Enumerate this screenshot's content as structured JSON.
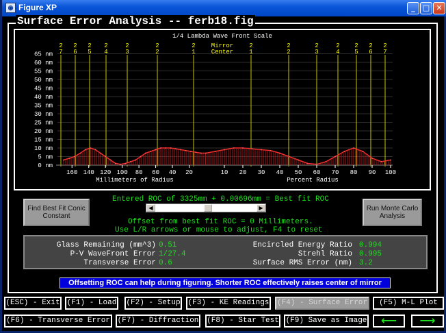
{
  "window": {
    "title": "Figure XP",
    "controls": [
      "_",
      "□",
      "✕"
    ]
  },
  "heading": "Surface Error Analysis -- ferb18.fig",
  "plot": {
    "title": "1/4 Lambda Wave Front Scale",
    "mirror_center_line1": "Mirror",
    "mirror_center_line2": "Center",
    "zone_labels": [
      [
        "2",
        "7"
      ],
      [
        "2",
        "6"
      ],
      [
        "2",
        "5"
      ],
      [
        "2",
        "4"
      ],
      [
        "2",
        "3"
      ],
      [
        "2",
        "2"
      ],
      [
        "2",
        "1"
      ],
      [
        "2",
        "1"
      ],
      [
        "2",
        "2"
      ],
      [
        "2",
        "3"
      ],
      [
        "2",
        "4"
      ],
      [
        "2",
        "5"
      ],
      [
        "2",
        "6"
      ],
      [
        "2",
        "7"
      ]
    ],
    "y_labels": [
      "65 nm",
      "60 nm",
      "55 nm",
      "50 nm",
      "45 nm",
      "40 nm",
      "35 nm",
      "30 nm",
      "25 nm",
      "20 nm",
      "15 nm",
      "10 nm",
      "5 nm",
      "0 nm"
    ],
    "x_left_ticks": [
      "160",
      "140",
      "120",
      "100",
      "80",
      "60",
      "40",
      "20"
    ],
    "x_right_ticks": [
      "10",
      "20",
      "30",
      "40",
      "50",
      "60",
      "70",
      "80",
      "90",
      "100"
    ],
    "x_left_label": "Millimeters of Radius",
    "x_right_label": "Percent Radius"
  },
  "buttons": {
    "best_fit": "Find Best Fit Conic Constant",
    "monte_carlo": "Run Monte Carlo Analysis"
  },
  "roc_line": "Entered ROC of 3325mm + 0.00696mm = Best fit ROC",
  "offset_line": "Offset from best fit ROC = 0 Millimeters.",
  "help_line": "Use L/R arrows or mouse to adjust, F4 to reset",
  "stats": {
    "glass_remaining": {
      "label": "Glass Remaining (mm^3)",
      "value": "0.51"
    },
    "pv_wavefront": {
      "label": "P-V WaveFront Error",
      "value": "1/27.4"
    },
    "transverse": {
      "label": "Transverse Error",
      "value": "0.6"
    },
    "encircled_energy": {
      "label": "Encircled Energy Ratio",
      "value": "0.994"
    },
    "strehl": {
      "label": "Strehl Ratio",
      "value": "0.995"
    },
    "surface_rms": {
      "label": "Surface RMS Error (nm)",
      "value": "3.2"
    }
  },
  "info_banner": "Offsetting ROC can help during figuring. Shorter ROC effectively raises center of mirror",
  "fkeys": {
    "exit": "(ESC) - Exit",
    "load": "(F1) - Load",
    "setup": "(F2) - Setup",
    "ke": "(F3) - KE Readings",
    "surface": "(F4) - Surface Error",
    "ml": "(F5) M-L Plot",
    "transverse": "(F6) - Transverse Error",
    "diffraction": "(F7) - Diffraction",
    "star": "(F8) - Star Test",
    "save": "(F9) Save as Image",
    "left_arrow": "⟵",
    "right_arrow": "⟶"
  },
  "chart_data": {
    "type": "area",
    "ylabel": "nm",
    "ylim": [
      0,
      65
    ],
    "left_x": [
      170,
      163,
      157,
      150,
      144,
      138,
      132,
      126,
      120,
      114,
      108,
      102,
      96,
      90,
      84,
      78,
      72,
      66,
      60,
      54,
      48,
      42,
      36,
      30,
      24,
      18,
      12,
      6,
      0
    ],
    "left_y": [
      3,
      4,
      5,
      7,
      9,
      10,
      9,
      7,
      5,
      3,
      1,
      0.5,
      1,
      2,
      3,
      5,
      7,
      8,
      9,
      10,
      10,
      10,
      9.5,
      9,
      8.5,
      8,
      7.5,
      7,
      7
    ],
    "right_x": [
      0,
      5,
      10,
      15,
      20,
      25,
      30,
      35,
      40,
      45,
      50,
      55,
      60,
      65,
      70,
      75,
      80,
      85,
      90,
      95,
      100
    ],
    "right_y": [
      7,
      8,
      9,
      10,
      10,
      9.5,
      9,
      8.5,
      7,
      5,
      3,
      1,
      0.5,
      2,
      5,
      8,
      10,
      8,
      4,
      2,
      3
    ]
  }
}
